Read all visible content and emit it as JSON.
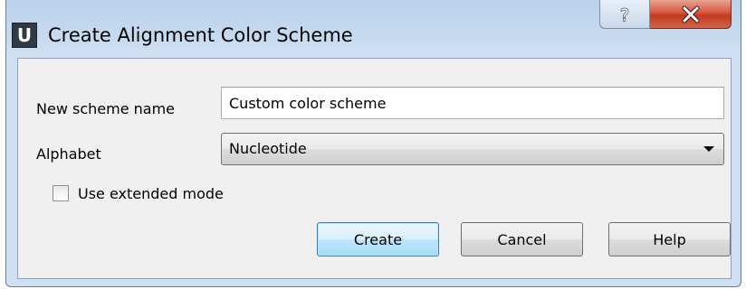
{
  "window": {
    "title": "Create Alignment Color Scheme",
    "app_icon_letter": "U",
    "help_glyph": "?",
    "close_glyph": "X"
  },
  "form": {
    "name_label": "New scheme name",
    "name_value": "Custom color scheme",
    "alphabet_label": "Alphabet",
    "alphabet_selected": "Nucleotide",
    "extended_mode_label": "Use extended mode",
    "extended_mode_checked": false
  },
  "buttons": {
    "create": "Create",
    "cancel": "Cancel",
    "help": "Help"
  },
  "colors": {
    "title_bar": "#b9d1ea",
    "close_button": "#c2391d",
    "default_button_border": "#3c7fb1"
  }
}
